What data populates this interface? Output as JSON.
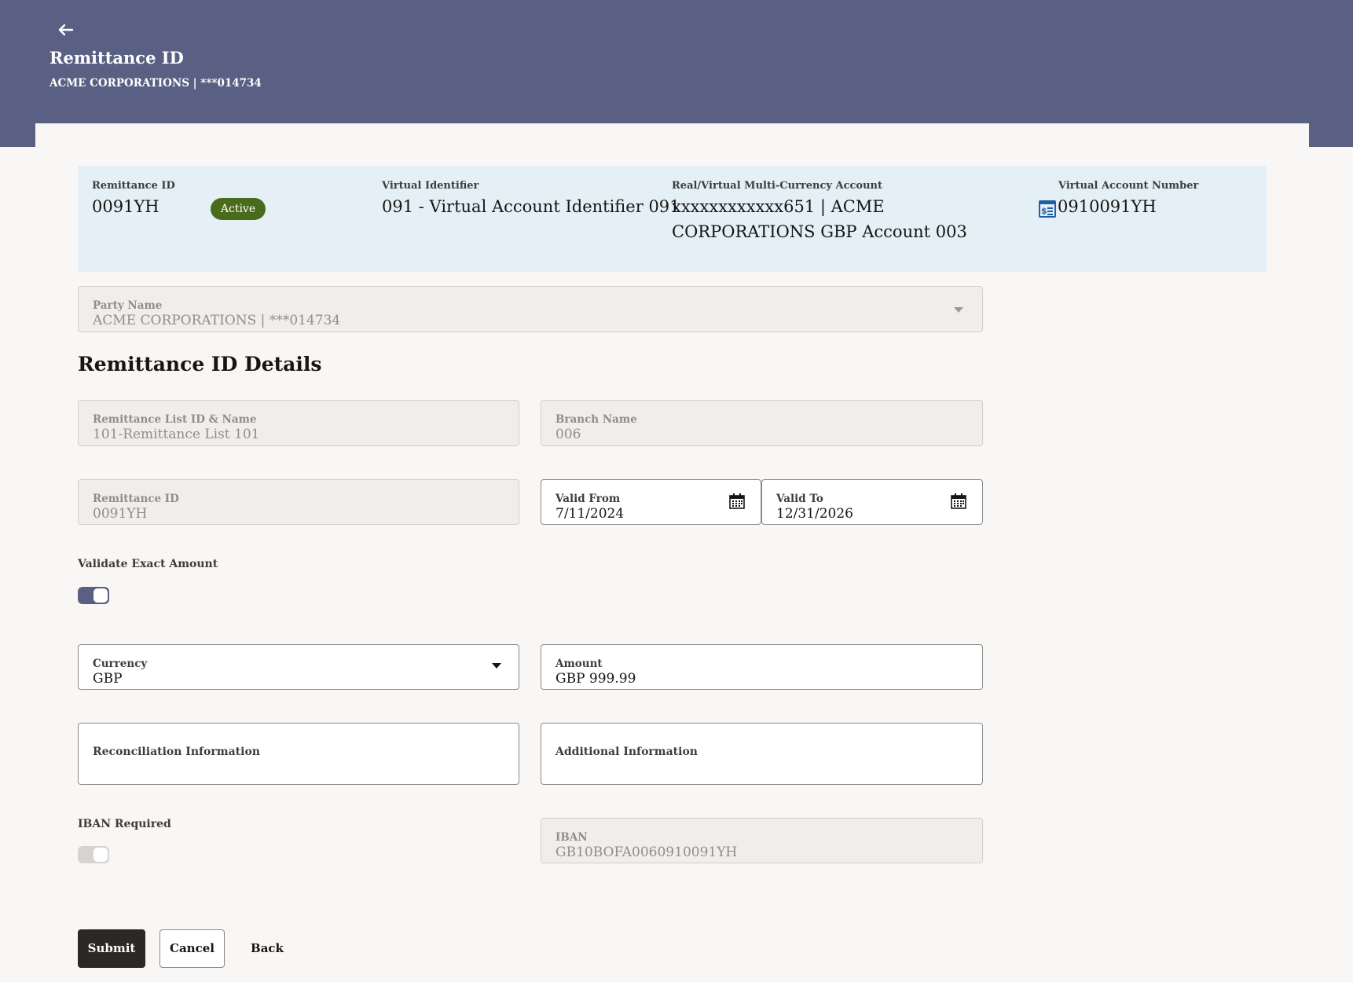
{
  "header": {
    "title": "Remittance ID",
    "subtitle": "ACME CORPORATIONS | ***014734"
  },
  "summary": {
    "remittance_id_label": "Remittance ID",
    "remittance_id_value": "0091YH",
    "status_badge": "Active",
    "virtual_identifier_label": "Virtual Identifier",
    "virtual_identifier_value": "091 - Virtual Account Identifier 091",
    "account_label": "Real/Virtual Multi-Currency Account",
    "account_value_line1": "xxxxxxxxxxxx651 | ACME",
    "account_value_line2": "CORPORATIONS GBP Account 003",
    "virtual_account_number_label": "Virtual Account Number",
    "virtual_account_number_value": "0910091YH"
  },
  "party": {
    "label": "Party Name",
    "value": "ACME CORPORATIONS | ***014734"
  },
  "section_title": "Remittance ID Details",
  "form": {
    "remittance_list": {
      "label": "Remittance List ID & Name",
      "value": "101-Remittance List 101"
    },
    "branch": {
      "label": "Branch Name",
      "value": "006"
    },
    "remittance_id": {
      "label": "Remittance ID",
      "value": "0091YH"
    },
    "valid_from": {
      "label": "Valid From",
      "value": "7/11/2024"
    },
    "valid_to": {
      "label": "Valid To",
      "value": "12/31/2026"
    },
    "validate_exact_amount": {
      "label": "Validate Exact Amount",
      "on": true
    },
    "currency": {
      "label": "Currency",
      "value": "GBP"
    },
    "amount": {
      "label": "Amount",
      "value": "GBP 999.99"
    },
    "reconciliation": {
      "label": "Reconciliation Information"
    },
    "additional": {
      "label": "Additional Information"
    },
    "iban_required": {
      "label": "IBAN Required",
      "on": false
    },
    "iban": {
      "label": "IBAN",
      "value": "GB10BOFA0060910091YH"
    }
  },
  "buttons": {
    "submit": "Submit",
    "cancel": "Cancel",
    "back": "Back"
  },
  "colors": {
    "header": "#5a6083",
    "summary_bg": "#e4f0f6",
    "badge": "#4a6b1c",
    "toggle_on": "#5a6083"
  }
}
